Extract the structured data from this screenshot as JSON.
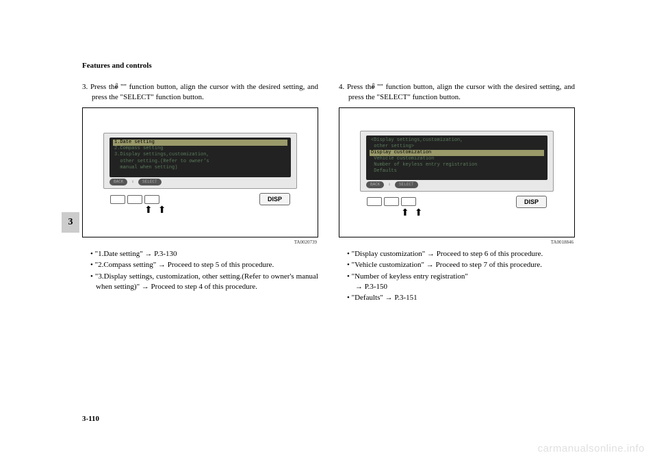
{
  "header": "Features and controls",
  "side_tab": "3",
  "page_number": "3-110",
  "watermark": "carmanualsonline.info",
  "left": {
    "step_num": "3.",
    "step_text_a": "Press the \"",
    "step_text_b": "\" function button, align the cursor with the desired setting, and press the \"SELECT\" function button.",
    "screen": {
      "line1": "1.Date setting",
      "line2": "2.Compass setting",
      "line3": "3.Display settings,customization,",
      "line4": "  other setting.(Refer to owner's",
      "line5": "  manual when setting)",
      "back": "BACK",
      "select": "SELECT"
    },
    "disp": "DISP",
    "figcode": "TA0020739",
    "bullets": {
      "b1": "\"1.Date setting\" → P.3-130",
      "b2": "\"2.Compass setting\" → Proceed to step 5 of this procedure.",
      "b3": "\"3.Display settings, customization, other setting.(Refer to owner's manual when setting)\" → Proceed to step 4 of this procedure."
    }
  },
  "right": {
    "step_num": "4.",
    "step_text_a": "Press the \"",
    "step_text_b": "\" function button, align the cursor with the desired setting, and press the \"SELECT\" function button.",
    "screen": {
      "line1": "<Display settings,customization,",
      "line1b": " other setting>",
      "line2": " Display customization",
      "line3": " Vehicle customization",
      "line4": " Number of keyless entry registration",
      "line5": " Defaults",
      "back": "BACK",
      "select": "SELECT"
    },
    "disp": "DISP",
    "figcode": "TA0018846",
    "bullets": {
      "b1": "\"Display customization\" → Proceed to step 6 of this procedure.",
      "b2": "\"Vehicle customization\" → Proceed to step 7 of this procedure.",
      "b3": "\"Number of keyless entry registration\"",
      "b3b": "→ P.3-150",
      "b4": "\"Defaults\" → P.3-151"
    }
  }
}
